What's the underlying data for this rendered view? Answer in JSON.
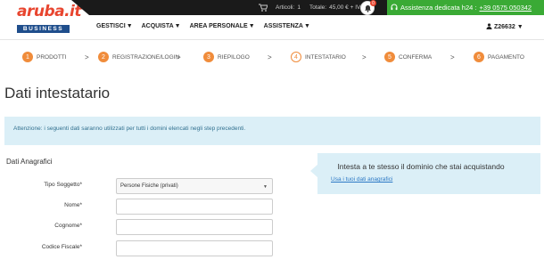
{
  "logo": {
    "brand": "aruba.it",
    "sub": "BUSINESS"
  },
  "topbar": {
    "cart": {
      "articoli_label": "Articoli:",
      "articoli_count": "1",
      "totale_label": "Totale:",
      "totale_value": "45,00 € + IVA"
    },
    "notifications": {
      "count": "0"
    },
    "assistance": {
      "text": "Assistenza dedicata h24 :",
      "phone": "+39 0575 050342"
    },
    "colors": {
      "dark": "#1a1a1a",
      "green": "#3aaa35",
      "orange": "#f08c3b",
      "red": "#e8452f"
    }
  },
  "nav": {
    "items": [
      {
        "label": "GESTISCI"
      },
      {
        "label": "ACQUISTA"
      },
      {
        "label": "AREA PERSONALE"
      },
      {
        "label": "ASSISTENZA"
      }
    ],
    "user": "Z26632"
  },
  "steps": [
    {
      "num": "1",
      "label": "PRODOTTI"
    },
    {
      "num": "2",
      "label": "REGISTRAZIONE/LOGIN"
    },
    {
      "num": "3",
      "label": "RIEPILOGO"
    },
    {
      "num": "4",
      "label": "INTESTATARIO"
    },
    {
      "num": "5",
      "label": "CONFERMA"
    },
    {
      "num": "6",
      "label": "PAGAMENTO"
    }
  ],
  "page_title": "Dati intestatario",
  "notice": "Attenzione: i seguenti dati saranno utilizzati per tutti i domini elencati negli step precedenti.",
  "form": {
    "section": "Dati Anagrafici",
    "tipo_soggetto": {
      "label": "Tipo Soggetto*",
      "value": "Persone Fisiche (privati)"
    },
    "nome": {
      "label": "Nome*",
      "value": ""
    },
    "cognome": {
      "label": "Cognome*",
      "value": ""
    },
    "codice_fiscale": {
      "label": "Codice Fiscale*",
      "value": ""
    }
  },
  "side_panel": {
    "title": "Intesta a te stesso il dominio che stai acquistando",
    "link": "Usa i tuoi dati anagrafici"
  }
}
